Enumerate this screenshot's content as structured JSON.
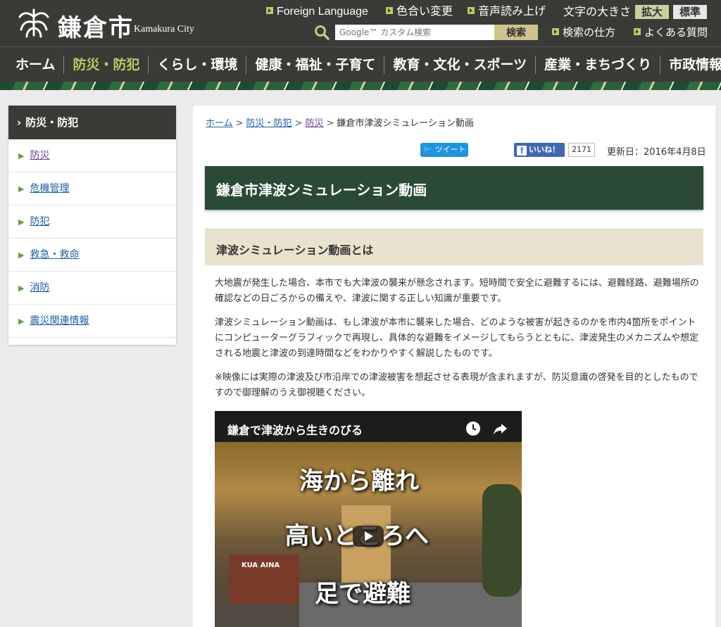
{
  "header": {
    "logo_text": "鎌倉市",
    "logo_sub": "Kamakura City",
    "links": {
      "foreign_language": "Foreign Language",
      "color_change": "色合い変更",
      "read_aloud": "音声読み上げ",
      "search_howto": "検索の仕方",
      "faq": "よくある質問"
    },
    "fontsize_label": "文字の大きさ",
    "fontsize_large": "拡大",
    "fontsize_normal": "標準",
    "search": {
      "placeholder": "Google™ カスタム検索",
      "button": "検索"
    }
  },
  "nav": {
    "items": [
      "ホーム",
      "防災・防犯",
      "くらし・環境",
      "健康・福祉・子育て",
      "教育・文化・スポーツ",
      "産業・まちづくり",
      "市政情報"
    ],
    "active_index": 1
  },
  "sidebar": {
    "heading": "防災・防犯",
    "items": [
      "防災",
      "危機管理",
      "防犯",
      "救急・救命",
      "消防",
      "震災関連情報"
    ]
  },
  "breadcrumb": {
    "items": [
      "ホーム",
      "防災・防犯",
      "防災"
    ],
    "current": "鎌倉市津波シミュレーション動画"
  },
  "social": {
    "tweet": "ツイート",
    "like": "いいね！",
    "like_count": "2171"
  },
  "updated": "更新日：2016年4月8日",
  "page_title": "鎌倉市津波シミュレーション動画",
  "section_title": "津波シミュレーション動画とは",
  "paragraphs": [
    "大地震が発生した場合、本市でも大津波の襲来が懸念されます。短時間で安全に避難するには、避難経路、避難場所の確認などの日ごろからの備えや、津波に関する正しい知識が重要です。",
    "津波シミュレーション動画は、もし津波が本市に襲来した場合、どのような被害が起きるのかを市内4箇所をポイントにコンピューターグラフィックで再現し、具体的な避難をイメージしてもらうとともに、津波発生のメカニズムや想定される地震と津波の到達時間などをわかりやすく解説したものです。",
    "※映像には実際の津波及び市沿岸での津波被害を想起させる表現が含まれますが、防災意識の啓発を目的としたものですので御理解のうえ御視聴ください。"
  ],
  "video": {
    "title": "鎌倉で津波から生きのびる",
    "captions": [
      "海から離れ",
      "高いところへ",
      "足で避難"
    ],
    "sign": "KUA AINA"
  },
  "colors": {
    "header_bg": "#3a3a37",
    "nav_active": "#b6cc66",
    "title_bg": "#2b4a36",
    "section_bg": "#e8e2cf",
    "link": "#1a5fa8"
  }
}
